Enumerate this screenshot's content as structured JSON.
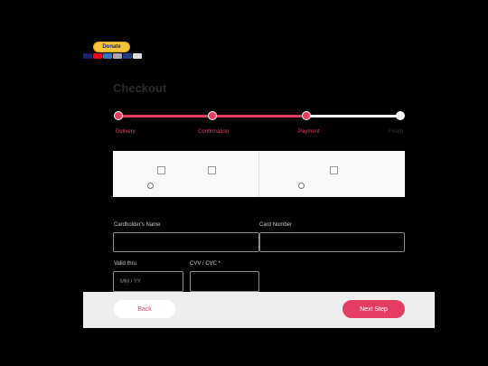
{
  "donate": {
    "label": "Donate"
  },
  "checkout": {
    "title": "Checkout"
  },
  "steps": [
    {
      "label": "Delivery",
      "state": "done"
    },
    {
      "label": "Confirmation",
      "state": "done"
    },
    {
      "label": "Payment",
      "state": "current"
    },
    {
      "label": "Finish",
      "state": "pending"
    }
  ],
  "payment_methods": [
    {
      "label": ""
    },
    {
      "label": ""
    }
  ],
  "form": {
    "cardholder_label": "Cardholder's Name",
    "card_number_label": "Card Number",
    "valid_thru_label": "Valid thru",
    "valid_thru_placeholder": "MM / YY",
    "cvv_label": "CVV / CVC *",
    "cvv_hint": ""
  },
  "buttons": {
    "back": "Back",
    "next": "Next Step"
  },
  "colors": {
    "accent": "#e53d62",
    "background": "#000000",
    "panel": "#f8f8f8",
    "footer": "#eeeeee"
  },
  "icons": [
    "paypal-donate-button",
    "visa-icon",
    "mastercard-icon",
    "amex-icon",
    "discover-icon",
    "broken-image-icon",
    "radio-icon"
  ]
}
